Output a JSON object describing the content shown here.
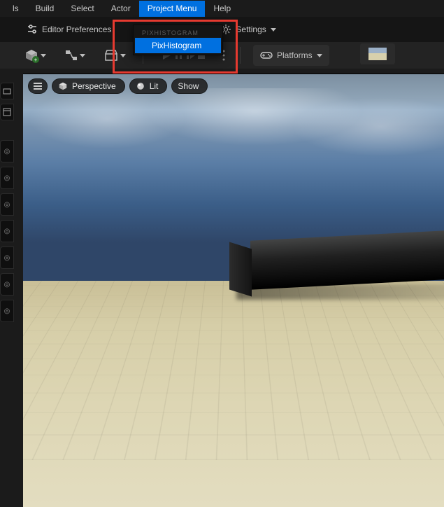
{
  "colors": {
    "accent": "#0070e0",
    "highlight_box": "#e63a30"
  },
  "menubar": {
    "items": [
      {
        "label": "ls"
      },
      {
        "label": "Build"
      },
      {
        "label": "Select"
      },
      {
        "label": "Actor"
      },
      {
        "label": "Project Menu",
        "active": true
      },
      {
        "label": "Help"
      }
    ]
  },
  "subtoolbar": {
    "editor_prefs": "Editor Preferences",
    "settings": "Settings"
  },
  "dropdown": {
    "header": "PIXHISTOGRAM",
    "items": [
      "PixHistogram"
    ]
  },
  "maintoolbar": {
    "platforms": "Platforms"
  },
  "viewport": {
    "menu": "≡",
    "perspective": "Perspective",
    "lit": "Lit",
    "show": "Show"
  },
  "icons": {
    "sliders": "sliders-icon",
    "gear": "gear-icon",
    "add_cube": "add-cube-icon",
    "nodes": "nodes-icon",
    "marketplace": "marketplace-icon",
    "play": "play-icon",
    "platforms": "gamepad-icon"
  }
}
